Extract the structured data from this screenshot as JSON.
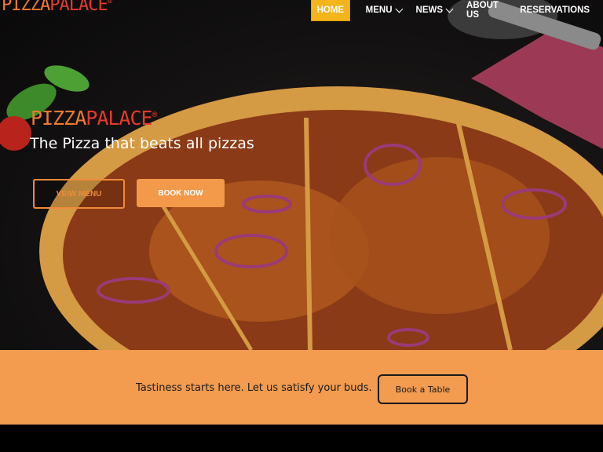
{
  "brand": {
    "part1": "PIZZA",
    "part2": "PALACE",
    "mark": "®"
  },
  "nav": {
    "home": "HOME",
    "items": [
      {
        "label": "MENU",
        "dropdown": true
      },
      {
        "label": "NEWS",
        "dropdown": true
      },
      {
        "label": "ABOUT US",
        "dropdown": false
      },
      {
        "label": "RESERVATIONS",
        "dropdown": false
      }
    ]
  },
  "hero": {
    "tagline": "The Pizza that beats all pizzas",
    "menu_button": "VEIW MENU",
    "book_button": "BOOK NOW"
  },
  "band": {
    "text": "Tastiness starts here. Let us satisfy your buds.",
    "button": "Book a Table"
  },
  "colors": {
    "accent": "#f3b51a",
    "orange": "#f39b4f",
    "red": "#e53a2b"
  }
}
